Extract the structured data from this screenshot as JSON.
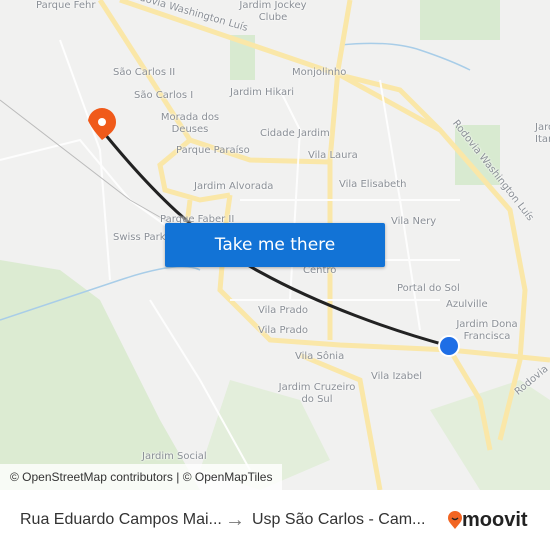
{
  "map": {
    "labels": [
      "Parque Fehr",
      "Rodovia Washington Luís",
      "Jardim Jockey Clube",
      "São Carlos II",
      "Monjolinho",
      "São Carlos I",
      "Jardim Hikari",
      "Morada dos Deuses",
      "Cidade Jardim",
      "Parque Paraíso",
      "Vila Laura",
      "Jardim Alvorada",
      "Vila Elisabeth",
      "Parque Faber II",
      "Vila Nery",
      "Swiss Park",
      "Centro",
      "Portal do Sol",
      "Azulville",
      "Jardim Dona Francisca",
      "Vila Prado",
      "Vila Prado",
      "Vila Sônia",
      "Vila Izabel",
      "Jardim Cruzeiro do Sul",
      "Jardim Social",
      "Rodovia Washington Luís",
      "Rodovia",
      "Jardim Itamarati"
    ],
    "route_color": "#222222",
    "origin_marker_color": "#1e6ee6",
    "destination_marker_color": "#f05a1a"
  },
  "cta": {
    "label": "Take me there"
  },
  "attribution": "© OpenStreetMap contributors | © OpenMapTiles",
  "footer": {
    "from": "Rua Eduardo Campos Mai...",
    "to": "Usp São Carlos - Cam...",
    "brand": "moovit",
    "brand_color": "#f26522"
  }
}
